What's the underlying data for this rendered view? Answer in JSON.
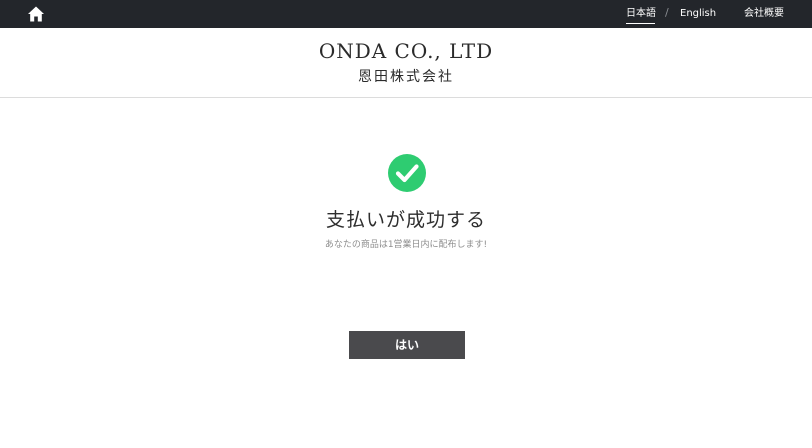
{
  "topbar": {
    "home_icon": "home-icon",
    "nav": {
      "japanese": "日本語",
      "separator": "/",
      "english": "English",
      "about": "会社概要"
    },
    "background": "#23262b"
  },
  "header": {
    "brand_en": "ONDA CO., LTD",
    "brand_jp": "恩田株式会社"
  },
  "result": {
    "icon": "check-circle-icon",
    "icon_color": "#2ecc71",
    "title": "支払いが成功する",
    "description": "あなたの商品は1営業日内に配布します!",
    "button_label": "はい",
    "button_color": "#4a4a4d"
  }
}
